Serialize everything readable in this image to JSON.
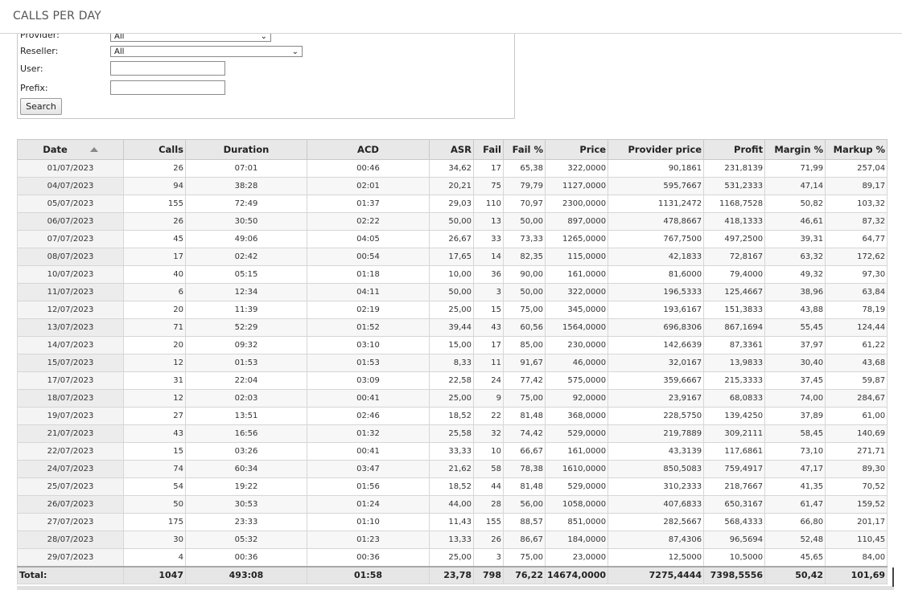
{
  "header": {
    "title": "CALLS PER DAY"
  },
  "filters": {
    "provider_label": "Provider:",
    "provider_value": "All",
    "reseller_label": "Reseller:",
    "reseller_value": "All",
    "user_label": "User:",
    "user_value": "",
    "prefix_label": "Prefix:",
    "prefix_value": "",
    "search_label": "Search"
  },
  "table": {
    "columns": [
      "Date",
      "Calls",
      "Duration",
      "ACD",
      "ASR",
      "Fail",
      "Fail %",
      "Price",
      "Provider price",
      "Profit",
      "Margin %",
      "Markup %"
    ],
    "sort_column": "Date",
    "rows": [
      [
        "01/07/2023",
        "26",
        "07:01",
        "00:46",
        "34,62",
        "17",
        "65,38",
        "322,0000",
        "90,1861",
        "231,8139",
        "71,99",
        "257,04"
      ],
      [
        "04/07/2023",
        "94",
        "38:28",
        "02:01",
        "20,21",
        "75",
        "79,79",
        "1127,0000",
        "595,7667",
        "531,2333",
        "47,14",
        "89,17"
      ],
      [
        "05/07/2023",
        "155",
        "72:49",
        "01:37",
        "29,03",
        "110",
        "70,97",
        "2300,0000",
        "1131,2472",
        "1168,7528",
        "50,82",
        "103,32"
      ],
      [
        "06/07/2023",
        "26",
        "30:50",
        "02:22",
        "50,00",
        "13",
        "50,00",
        "897,0000",
        "478,8667",
        "418,1333",
        "46,61",
        "87,32"
      ],
      [
        "07/07/2023",
        "45",
        "49:06",
        "04:05",
        "26,67",
        "33",
        "73,33",
        "1265,0000",
        "767,7500",
        "497,2500",
        "39,31",
        "64,77"
      ],
      [
        "08/07/2023",
        "17",
        "02:42",
        "00:54",
        "17,65",
        "14",
        "82,35",
        "115,0000",
        "42,1833",
        "72,8167",
        "63,32",
        "172,62"
      ],
      [
        "10/07/2023",
        "40",
        "05:15",
        "01:18",
        "10,00",
        "36",
        "90,00",
        "161,0000",
        "81,6000",
        "79,4000",
        "49,32",
        "97,30"
      ],
      [
        "11/07/2023",
        "6",
        "12:34",
        "04:11",
        "50,00",
        "3",
        "50,00",
        "322,0000",
        "196,5333",
        "125,4667",
        "38,96",
        "63,84"
      ],
      [
        "12/07/2023",
        "20",
        "11:39",
        "02:19",
        "25,00",
        "15",
        "75,00",
        "345,0000",
        "193,6167",
        "151,3833",
        "43,88",
        "78,19"
      ],
      [
        "13/07/2023",
        "71",
        "52:29",
        "01:52",
        "39,44",
        "43",
        "60,56",
        "1564,0000",
        "696,8306",
        "867,1694",
        "55,45",
        "124,44"
      ],
      [
        "14/07/2023",
        "20",
        "09:32",
        "03:10",
        "15,00",
        "17",
        "85,00",
        "230,0000",
        "142,6639",
        "87,3361",
        "37,97",
        "61,22"
      ],
      [
        "15/07/2023",
        "12",
        "01:53",
        "01:53",
        "8,33",
        "11",
        "91,67",
        "46,0000",
        "32,0167",
        "13,9833",
        "30,40",
        "43,68"
      ],
      [
        "17/07/2023",
        "31",
        "22:04",
        "03:09",
        "22,58",
        "24",
        "77,42",
        "575,0000",
        "359,6667",
        "215,3333",
        "37,45",
        "59,87"
      ],
      [
        "18/07/2023",
        "12",
        "02:03",
        "00:41",
        "25,00",
        "9",
        "75,00",
        "92,0000",
        "23,9167",
        "68,0833",
        "74,00",
        "284,67"
      ],
      [
        "19/07/2023",
        "27",
        "13:51",
        "02:46",
        "18,52",
        "22",
        "81,48",
        "368,0000",
        "228,5750",
        "139,4250",
        "37,89",
        "61,00"
      ],
      [
        "21/07/2023",
        "43",
        "16:56",
        "01:32",
        "25,58",
        "32",
        "74,42",
        "529,0000",
        "219,7889",
        "309,2111",
        "58,45",
        "140,69"
      ],
      [
        "22/07/2023",
        "15",
        "03:26",
        "00:41",
        "33,33",
        "10",
        "66,67",
        "161,0000",
        "43,3139",
        "117,6861",
        "73,10",
        "271,71"
      ],
      [
        "24/07/2023",
        "74",
        "60:34",
        "03:47",
        "21,62",
        "58",
        "78,38",
        "1610,0000",
        "850,5083",
        "759,4917",
        "47,17",
        "89,30"
      ],
      [
        "25/07/2023",
        "54",
        "19:22",
        "01:56",
        "18,52",
        "44",
        "81,48",
        "529,0000",
        "310,2333",
        "218,7667",
        "41,35",
        "70,52"
      ],
      [
        "26/07/2023",
        "50",
        "30:53",
        "01:24",
        "44,00",
        "28",
        "56,00",
        "1058,0000",
        "407,6833",
        "650,3167",
        "61,47",
        "159,52"
      ],
      [
        "27/07/2023",
        "175",
        "23:33",
        "01:10",
        "11,43",
        "155",
        "88,57",
        "851,0000",
        "282,5667",
        "568,4333",
        "66,80",
        "201,17"
      ],
      [
        "28/07/2023",
        "30",
        "05:32",
        "01:23",
        "13,33",
        "26",
        "86,67",
        "184,0000",
        "87,4306",
        "96,5694",
        "52,48",
        "110,45"
      ],
      [
        "29/07/2023",
        "4",
        "00:36",
        "00:36",
        "25,00",
        "3",
        "75,00",
        "23,0000",
        "12,5000",
        "10,5000",
        "45,65",
        "84,00"
      ]
    ],
    "total": [
      "Total:",
      "1047",
      "493:08",
      "01:58",
      "23,78",
      "798",
      "76,22",
      "14674,0000",
      "7275,4444",
      "7398,5556",
      "50,42",
      "101,69"
    ]
  }
}
